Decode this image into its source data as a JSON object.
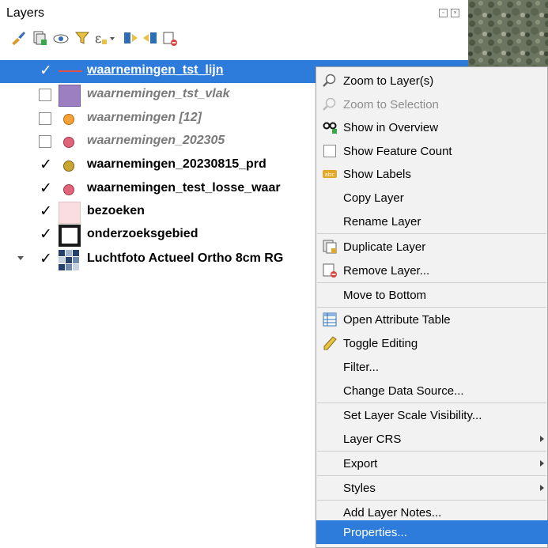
{
  "panel": {
    "title": "Layers"
  },
  "toolbar": {
    "icons": [
      "style-brush-icon",
      "add-group-icon",
      "visibility-eye-icon",
      "filter-legend-icon",
      "expression-filter-icon",
      "expand-all-icon",
      "collapse-all-icon",
      "remove-layer-icon"
    ]
  },
  "layers": [
    {
      "name": "waarnemingen_tst_lijn",
      "checked": true,
      "selected": true,
      "symbol": "line",
      "color": "#e0504a",
      "disabled": false
    },
    {
      "name": "waarnemingen_tst_vlak",
      "checked": false,
      "selected": false,
      "symbol": "fill",
      "color": "#9c7fc0",
      "disabled": true
    },
    {
      "name": "waarnemingen [12]",
      "checked": false,
      "selected": false,
      "symbol": "point",
      "color": "#f5a13a",
      "disabled": true
    },
    {
      "name": "waarnemingen_202305",
      "checked": false,
      "selected": false,
      "symbol": "point",
      "color": "#e0647a",
      "disabled": true
    },
    {
      "name": "waarnemingen_20230815_prd",
      "checked": true,
      "selected": false,
      "symbol": "point",
      "color": "#c9a632",
      "disabled": false
    },
    {
      "name": "waarnemingen_test_losse_waar",
      "checked": true,
      "selected": false,
      "symbol": "point",
      "color": "#e0647a",
      "disabled": false
    },
    {
      "name": "bezoeken",
      "checked": true,
      "selected": false,
      "symbol": "fill",
      "color": "#f9dde0",
      "disabled": false
    },
    {
      "name": "onderzoeksgebied",
      "checked": true,
      "selected": false,
      "symbol": "outline",
      "color": "#1a1a1a",
      "disabled": false
    },
    {
      "name": "Luchtfoto Actueel Ortho 8cm RG",
      "checked": true,
      "selected": false,
      "symbol": "raster",
      "color": "#25406a",
      "disabled": false,
      "expandable": true
    }
  ],
  "context_menu": {
    "items": [
      {
        "label": "Zoom to Layer(s)",
        "icon": "zoom-layer-icon",
        "disabled": false
      },
      {
        "label": "Zoom to Selection",
        "icon": "zoom-selection-icon",
        "disabled": true
      },
      {
        "label": "Show in Overview",
        "icon": "overview-glasses-icon",
        "disabled": false
      },
      {
        "label": "Show Feature Count",
        "icon": "checkbox-icon",
        "disabled": false
      },
      {
        "label": "Show Labels",
        "icon": "labels-abc-icon",
        "disabled": false
      },
      {
        "label": "Copy Layer",
        "icon": "",
        "disabled": false
      },
      {
        "label": "Rename Layer",
        "icon": "",
        "disabled": false
      },
      {
        "label": "Duplicate Layer",
        "icon": "duplicate-layer-icon",
        "disabled": false
      },
      {
        "label": "Remove Layer...",
        "icon": "remove-layer-icon",
        "disabled": false
      },
      {
        "label": "Move to Bottom",
        "icon": "",
        "disabled": false
      },
      {
        "label": "Open Attribute Table",
        "icon": "attribute-table-icon",
        "disabled": false
      },
      {
        "label": "Toggle Editing",
        "icon": "pencil-icon",
        "disabled": false
      },
      {
        "label": "Filter...",
        "icon": "",
        "disabled": false
      },
      {
        "label": "Change Data Source...",
        "icon": "",
        "disabled": false
      },
      {
        "label": "Set Layer Scale Visibility...",
        "icon": "",
        "disabled": false
      },
      {
        "label": "Layer CRS",
        "icon": "",
        "disabled": false,
        "submenu": true
      },
      {
        "label": "Export",
        "icon": "",
        "disabled": false,
        "submenu": true
      },
      {
        "label": "Styles",
        "icon": "",
        "disabled": false,
        "submenu": true
      },
      {
        "label": "Add Layer Notes...",
        "icon": "",
        "disabled": false
      },
      {
        "label": "Properties...",
        "icon": "",
        "disabled": false,
        "highlighted": true
      }
    ]
  },
  "colors": {
    "selection": "#2d7cdc",
    "menu_bg": "#f2f2f2"
  }
}
